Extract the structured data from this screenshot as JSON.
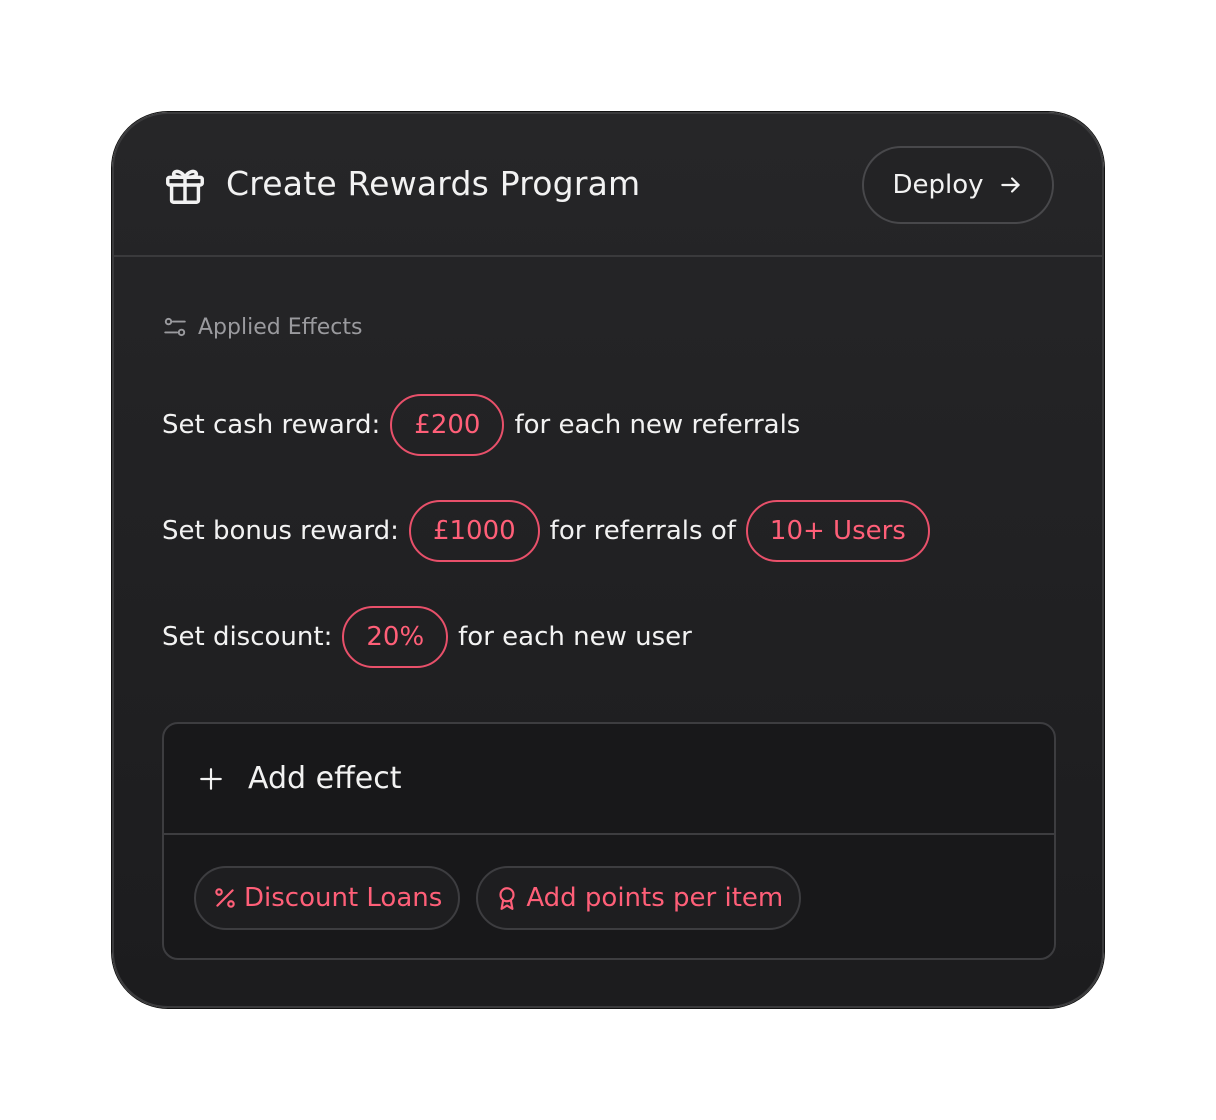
{
  "header": {
    "title": "Create Rewards Program",
    "deploy_label": "Deploy",
    "icon": "gift-icon"
  },
  "section": {
    "label": "Applied Effects",
    "icon": "sliders-icon"
  },
  "effects": [
    {
      "prefix": "Set cash reward:",
      "value": "£200",
      "middle": "for each new referrals"
    },
    {
      "prefix": "Set bonus reward:",
      "value": "£1000",
      "middle": "for referrals of",
      "value2": "10+ Users"
    },
    {
      "prefix": "Set discount:",
      "value": "20%",
      "middle": "for each new user"
    }
  ],
  "add_effect": {
    "label": "Add effect",
    "suggestions": [
      {
        "label": "Discount Loans",
        "icon": "percent-icon"
      },
      {
        "label": "Add points per item",
        "icon": "award-icon"
      }
    ]
  },
  "colors": {
    "accent": "#ff5f78",
    "card_bg": "#222224",
    "text": "#f2f2f2",
    "muted": "#9a9a9e"
  }
}
